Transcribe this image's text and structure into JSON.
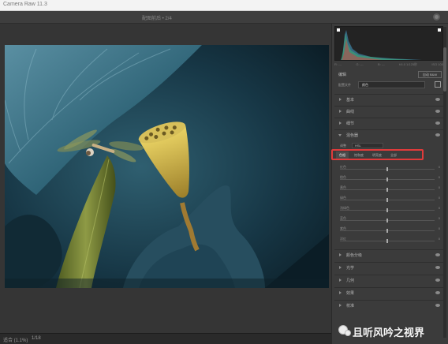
{
  "app": {
    "title": "Camera Raw 11.3"
  },
  "document": {
    "title": "配图前后 • 2/4"
  },
  "status": {
    "zoom_label": "适合 (1.1%)",
    "zoom_value": "1/18"
  },
  "histogram_info": {
    "r": "R: ---",
    "g": "G: ---",
    "b": "B: ---",
    "temp": "f/4.0  1/125秒",
    "iso": "ISO 100"
  },
  "panel": {
    "title": "编辑",
    "edit_button": "自动  B&W",
    "profile_label": "配置文件",
    "profile_value": "颜色"
  },
  "sections": [
    {
      "label": "基本",
      "open": false
    },
    {
      "label": "曲线",
      "open": false
    },
    {
      "label": "细节",
      "open": false
    },
    {
      "label": "混色器",
      "open": true
    }
  ],
  "mixer": {
    "adjust_label": "调整",
    "adjust_value": "HSL",
    "tabs": [
      "色相",
      "饱和度",
      "明亮度",
      "全部"
    ],
    "sliders": [
      {
        "label": "红色",
        "value": "0",
        "pos": 0.5
      },
      {
        "label": "橙色",
        "value": "0",
        "pos": 0.5
      },
      {
        "label": "黄色",
        "value": "0",
        "pos": 0.5
      },
      {
        "label": "绿色",
        "value": "0",
        "pos": 0.5
      },
      {
        "label": "浅绿色",
        "value": "0",
        "pos": 0.5
      },
      {
        "label": "蓝色",
        "value": "0",
        "pos": 0.5
      },
      {
        "label": "紫色",
        "value": "0",
        "pos": 0.5
      },
      {
        "label": "洋红",
        "value": "0",
        "pos": 0.5
      }
    ]
  },
  "more_sections": [
    {
      "label": "颜色分级"
    },
    {
      "label": "光学"
    },
    {
      "label": "几何"
    },
    {
      "label": "效果"
    },
    {
      "label": "校准"
    }
  ],
  "watermark": {
    "text": "且听风吟之视界"
  },
  "colors": {
    "highlight": "#e03b3b",
    "panel_bg": "#3b3b3b",
    "canvas_bg": "#353535"
  }
}
